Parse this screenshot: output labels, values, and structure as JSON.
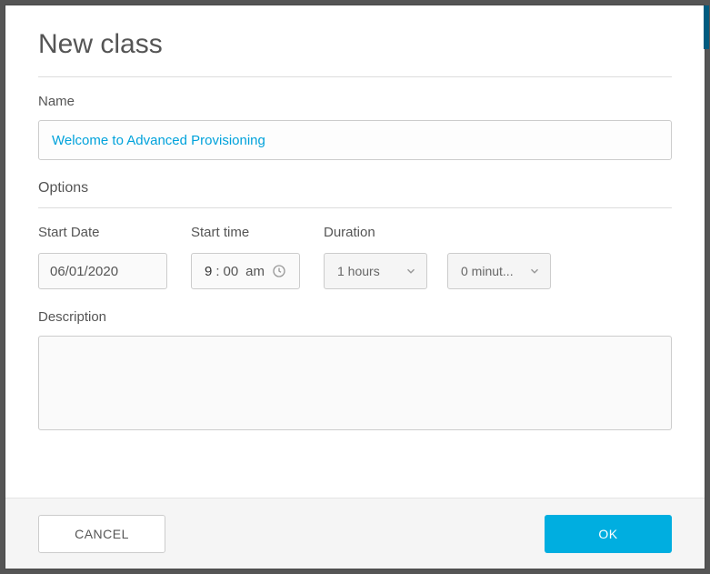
{
  "dialog": {
    "title": "New class"
  },
  "name": {
    "label": "Name",
    "value": "Welcome to Advanced Provisioning"
  },
  "options": {
    "title": "Options",
    "start_date": {
      "label": "Start Date",
      "value": "06/01/2020"
    },
    "start_time": {
      "label": "Start time",
      "hour": "9",
      "minute": "00",
      "ampm": "am"
    },
    "duration": {
      "label": "Duration",
      "hours_label": "1 hours",
      "minutes_label": "0 minut..."
    },
    "description": {
      "label": "Description",
      "value": ""
    }
  },
  "footer": {
    "cancel_label": "CANCEL",
    "ok_label": "OK"
  }
}
